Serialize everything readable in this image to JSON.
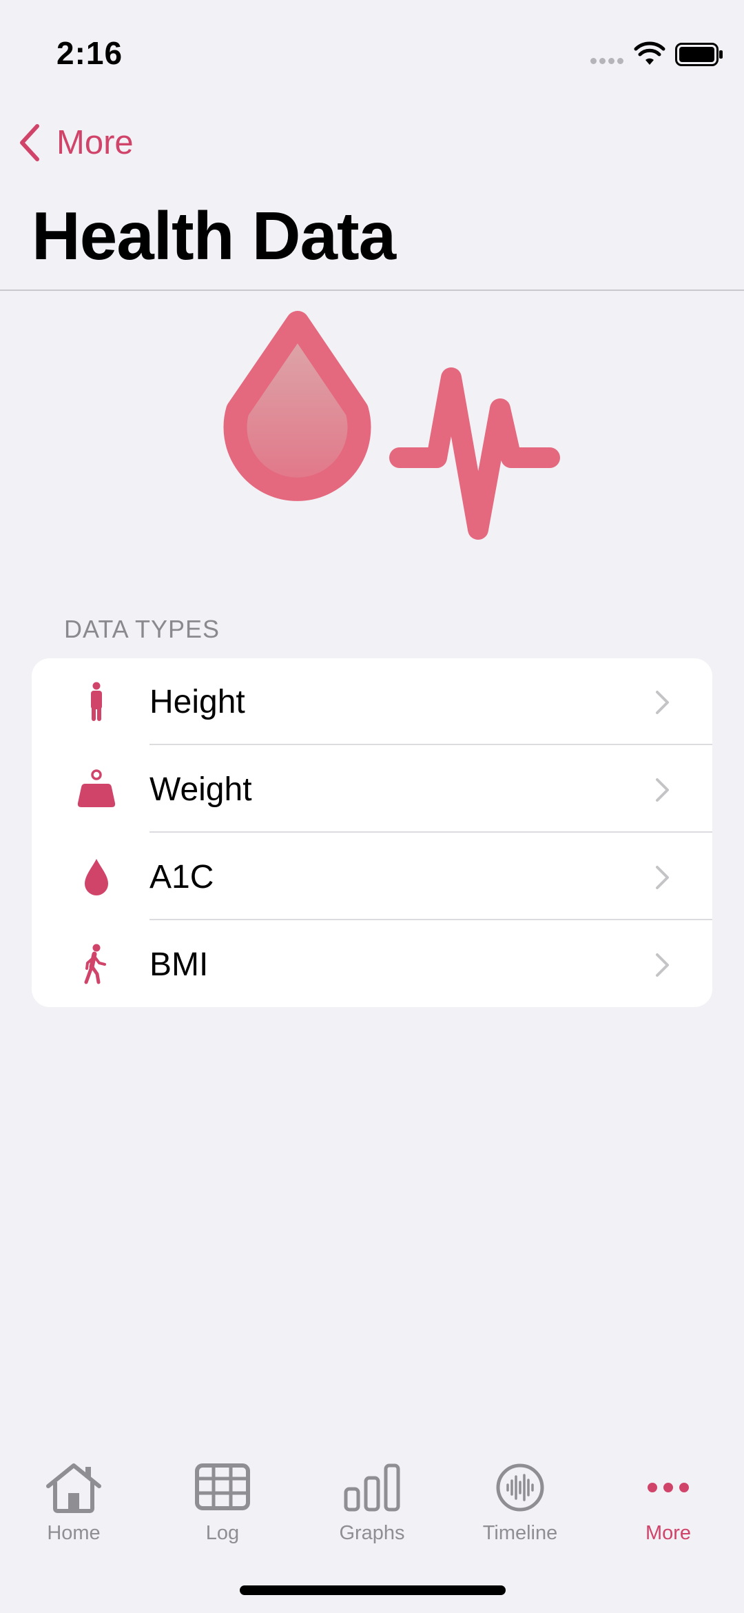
{
  "status_bar": {
    "time": "2:16"
  },
  "nav": {
    "back_label": "More",
    "title": "Health Data"
  },
  "section": {
    "header": "DATA TYPES"
  },
  "rows": [
    {
      "label": "Height",
      "icon": "person-standing-icon"
    },
    {
      "label": "Weight",
      "icon": "scale-weight-icon"
    },
    {
      "label": "A1C",
      "icon": "drop-icon"
    },
    {
      "label": "BMI",
      "icon": "figure-walk-icon"
    }
  ],
  "tabs": [
    {
      "label": "Home",
      "icon": "house-icon",
      "active": false
    },
    {
      "label": "Log",
      "icon": "table-grid-icon",
      "active": false
    },
    {
      "label": "Graphs",
      "icon": "bar-chart-icon",
      "active": false
    },
    {
      "label": "Timeline",
      "icon": "waveform-circle-icon",
      "active": false
    },
    {
      "label": "More",
      "icon": "ellipsis-icon",
      "active": true
    }
  ],
  "colors": {
    "accent": "#d0446a",
    "hero": "#e4687e",
    "background": "#f2f1f6",
    "inactive": "#8e8e93"
  }
}
